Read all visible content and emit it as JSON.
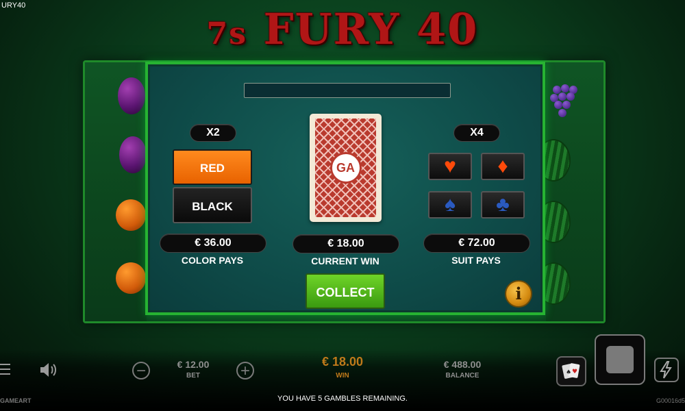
{
  "window": {
    "title": "URY40"
  },
  "logo": {
    "text_7s": "7s",
    "text_main": "FURY 40"
  },
  "gamble": {
    "color_multiplier": "X2",
    "suit_multiplier": "X4",
    "red_label": "RED",
    "black_label": "BLACK",
    "color_pays_value": "€ 36.00",
    "color_pays_label": "COLOR PAYS",
    "current_win_value": "€ 18.00",
    "current_win_label": "CURRENT WIN",
    "suit_pays_value": "€ 72.00",
    "suit_pays_label": "SUIT PAYS",
    "collect_label": "COLLECT",
    "card_logo": "GA",
    "info_label": "i",
    "suits": {
      "hearts": "♥",
      "diamonds": "♦",
      "spades": "♠",
      "clubs": "♣"
    }
  },
  "bottom": {
    "bet_value": "€ 12.00",
    "bet_label": "BET",
    "win_value": "€ 18.00",
    "win_label": "WIN",
    "balance_value": "€ 488.00",
    "balance_label": "BALANCE",
    "minus": "−",
    "plus": "+",
    "message": "YOU HAVE 5 GAMBLES REMAINING.",
    "brand": "GAMEART",
    "build": "G00016d5"
  },
  "colors": {
    "red_button": "#ff7a10",
    "collect_button": "#52b81c",
    "win_text": "#c07a1a",
    "panel_border": "#27b332"
  },
  "icons": [
    "menu-icon",
    "sound-icon",
    "minus-icon",
    "plus-icon",
    "gamble-cards-icon",
    "spin-stop-icon",
    "turbo-icon",
    "info-icon",
    "heart-icon",
    "diamond-icon",
    "spade-icon",
    "club-icon"
  ]
}
